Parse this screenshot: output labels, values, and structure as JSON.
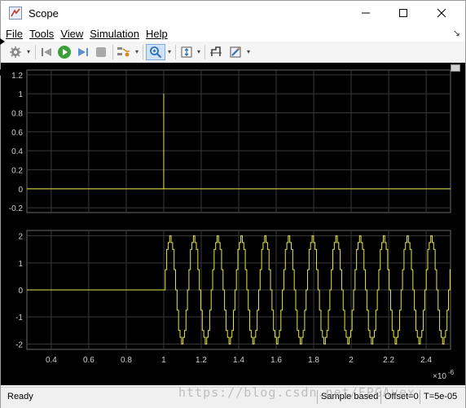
{
  "window": {
    "title": "Scope",
    "minimize": "minimize",
    "maximize": "maximize",
    "close": "close"
  },
  "menu": [
    "File",
    "Tools",
    "View",
    "Simulation",
    "Help"
  ],
  "toolbar": {
    "icons": [
      "gear-icon",
      "step-back-icon",
      "run-icon",
      "step-forward-icon",
      "stop-icon",
      "highlight-signal-icon",
      "zoom-icon",
      "scale-axes-icon",
      "cursor-measure-icon",
      "style-icon"
    ]
  },
  "status": {
    "state": "Ready",
    "mode": "Sample based",
    "offset": "Offset=0",
    "time": "T=5e-05"
  },
  "watermark": "https://blog.csdn.net/FPGAvex",
  "colors": {
    "plot_bg": "#000000",
    "axes_bg": "#000000",
    "grid": "#3a3a3a",
    "trace": "#e6e64c",
    "tick_text": "#cfcfcf"
  },
  "chart_data": [
    {
      "type": "line",
      "title": "",
      "ylim": [
        -0.25,
        1.25
      ],
      "yticks": [
        1.2,
        1,
        0.8,
        0.6,
        0.4,
        0.2,
        0,
        -0.2
      ],
      "ytick_labels": [
        "1.2",
        "1",
        "0.8",
        "0.6",
        "0.4",
        "0.2",
        "0",
        "-0.2"
      ],
      "xlim": [
        0.27,
        2.53
      ],
      "xticks": [
        0.4,
        0.6,
        0.8,
        1,
        1.2,
        1.4,
        1.6,
        1.8,
        2,
        2.2,
        2.4
      ],
      "grid": true,
      "series": [
        {
          "x": [
            0.27,
            1.0,
            1.0,
            1.0,
            1.0,
            2.53
          ],
          "y": [
            0,
            0,
            1,
            1,
            0,
            0
          ]
        }
      ]
    },
    {
      "type": "line",
      "title": "",
      "ylim": [
        -2.2,
        2.2
      ],
      "yticks": [
        2,
        1,
        0,
        -1,
        -2
      ],
      "ytick_labels": [
        "2",
        "1",
        "0",
        "-1",
        "-2"
      ],
      "xlim": [
        0.27,
        2.53
      ],
      "xticks": [
        0.4,
        0.6,
        0.8,
        1,
        1.2,
        1.4,
        1.6,
        1.8,
        2,
        2.2,
        2.4
      ],
      "xtick_labels": [
        "0.4",
        "0.6",
        "0.8",
        "1",
        "1.2",
        "1.4",
        "1.6",
        "1.8",
        "2",
        "2.2",
        "2.4"
      ],
      "x_exponent": "×10",
      "x_exponent_power": "-6",
      "grid": true,
      "series": [
        {
          "signal_start": 1.0,
          "amplitude": 2,
          "period": 0.1266,
          "samples_per_period": 16,
          "pre_value": 0
        }
      ]
    }
  ]
}
